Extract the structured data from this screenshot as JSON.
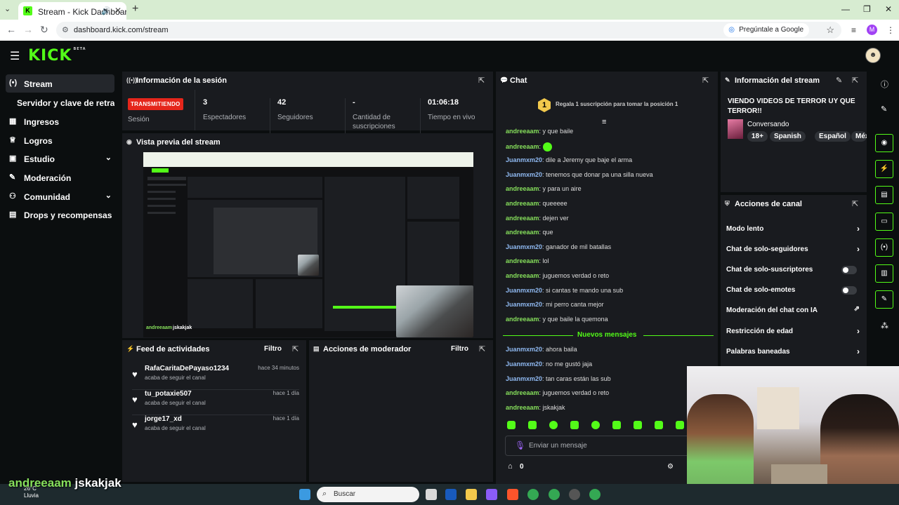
{
  "browser": {
    "tab_title": "Stream - Kick Dashboard",
    "url": "dashboard.kick.com/stream",
    "ask_google": "Pregúntale a Google",
    "profile_initial": "M"
  },
  "app": {
    "logo": "KICK",
    "logo_badge": "BETA",
    "accent_color": "#53fc18"
  },
  "sidebar": {
    "items": [
      {
        "label": "Stream",
        "icon": "broadcast-icon"
      },
      {
        "label": "Servidor y clave de retransmisión",
        "icon": ""
      },
      {
        "label": "Ingresos",
        "icon": "revenue-icon"
      },
      {
        "label": "Logros",
        "icon": "trophy-icon"
      },
      {
        "label": "Estudio",
        "icon": "studio-icon"
      },
      {
        "label": "Moderación",
        "icon": "wrench-icon"
      },
      {
        "label": "Comunidad",
        "icon": "community-icon"
      },
      {
        "label": "Drops y recompensas",
        "icon": "drops-icon"
      }
    ]
  },
  "session": {
    "title": "Información de la sesión",
    "live_badge": "TRANSMITIENDO",
    "session_label": "Sesión",
    "stats": [
      {
        "value": "3",
        "label": "Espectadores"
      },
      {
        "value": "42",
        "label": "Seguidores"
      },
      {
        "value": "-",
        "label": "Cantidad de suscripciones"
      },
      {
        "value": "01:06:18",
        "label": "Tiempo en vivo"
      }
    ]
  },
  "preview": {
    "title": "Vista previa del stream",
    "overlay_user": "andreeaam",
    "overlay_msg": "jskakjak"
  },
  "feed": {
    "title": "Feed de actividades",
    "filter": "Filtro",
    "items": [
      {
        "name": "RafaCaritaDePayaso1234",
        "time": "hace 34 minutos",
        "sub": "acaba de seguir el canal"
      },
      {
        "name": "tu_potaxie507",
        "time": "hace 1 día",
        "sub": "acaba de seguir el canal"
      },
      {
        "name": "jorge17_xd",
        "time": "hace 1 día",
        "sub": "acaba de seguir el canal"
      }
    ]
  },
  "modactions": {
    "title": "Acciones de moderador",
    "filter": "Filtro"
  },
  "chat": {
    "title": "Chat",
    "gift_rank": "1",
    "gift_text": "Regala 1 suscripción para tomar la posición 1",
    "messages": [
      {
        "user": "andreeaam",
        "color": "g",
        "text": "y que baile"
      },
      {
        "user": "andreeaam",
        "color": "g",
        "text": ""
      },
      {
        "user": "Juanmxm20",
        "color": "b",
        "text": "dile a Jeremy que baje el arma"
      },
      {
        "user": "Juanmxm20",
        "color": "b",
        "text": "tenemos que donar pa una silla nueva"
      },
      {
        "user": "andreeaam",
        "color": "g",
        "text": "y para un aire"
      },
      {
        "user": "andreeaam",
        "color": "g",
        "text": "queeeee"
      },
      {
        "user": "andreeaam",
        "color": "g",
        "text": "dejen ver"
      },
      {
        "user": "andreeaam",
        "color": "g",
        "text": "que"
      },
      {
        "user": "Juanmxm20",
        "color": "b",
        "text": "ganador de mil batallas"
      },
      {
        "user": "andreeaam",
        "color": "g",
        "text": "lol"
      },
      {
        "user": "andreeaam",
        "color": "g",
        "text": "juguemos verdad o reto"
      },
      {
        "user": "Juanmxm20",
        "color": "b",
        "text": "si cantas te mando una sub"
      },
      {
        "user": "Juanmxm20",
        "color": "b",
        "text": "mi perro canta mejor"
      },
      {
        "user": "andreeaam",
        "color": "g",
        "text": "y que baile la quemona"
      }
    ],
    "new_messages_label": "Nuevos mensajes",
    "new_messages": [
      {
        "user": "Juanmxm20",
        "color": "b",
        "text": "ahora baila"
      },
      {
        "user": "Juanmxm20",
        "color": "b",
        "text": "no me gustó jaja"
      },
      {
        "user": "Juanmxm20",
        "color": "b",
        "text": "tan caras están las sub"
      },
      {
        "user": "andreeaam",
        "color": "g",
        "text": "juguemos verdad o reto"
      },
      {
        "user": "andreeaam",
        "color": "g",
        "text": "jskakjak"
      }
    ],
    "input_placeholder": "Enviar un mensaje",
    "points": "0"
  },
  "stream_info": {
    "title": "Información del stream",
    "stream_title": "VIENDO VIDEOS DE TERROR UY QUE TERROR!!",
    "category": "Conversando",
    "tags": [
      "18+",
      "Spanish",
      "Español",
      "Méxi"
    ]
  },
  "channel_actions": {
    "title": "Acciones de canal",
    "rows": [
      {
        "label": "Modo lento",
        "control": "chevron"
      },
      {
        "label": "Chat de solo-seguidores",
        "control": "chevron"
      },
      {
        "label": "Chat de solo-suscriptores",
        "control": "toggle"
      },
      {
        "label": "Chat de solo-emotes",
        "control": "toggle"
      },
      {
        "label": "Moderación del chat con IA",
        "control": "external"
      },
      {
        "label": "Restricción de edad",
        "control": "chevron"
      },
      {
        "label": "Palabras baneadas",
        "control": "chevron"
      }
    ]
  },
  "taskbar": {
    "search": "Buscar",
    "weather_temp": "26°C",
    "weather_text": "Lluvia"
  },
  "overlay": {
    "user": "andreeaam",
    "message": "jskakjak"
  }
}
